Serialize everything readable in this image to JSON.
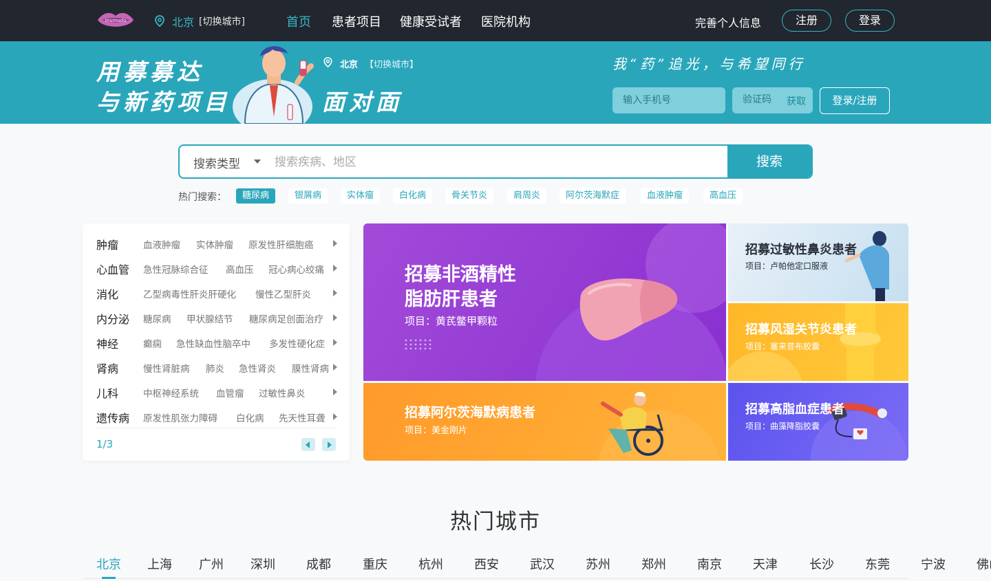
{
  "topnav": {
    "logo_text": "mumuda",
    "city": "北京",
    "switch_city": "[切换城市]",
    "nav": [
      "首页",
      "患者项目",
      "健康受试者",
      "医院机构"
    ],
    "complete_info": "完善个人信息",
    "register": "注册",
    "login": "登录"
  },
  "banner": {
    "slogan_line1": "用募募达",
    "slogan_line2": "与新药项目",
    "slogan_line3": "面对面",
    "city": "北京",
    "switch_city": "【切换城市】",
    "tagline": "我“药”追光，与希望同行",
    "phone_placeholder": "输入手机号",
    "code_placeholder": "验证码",
    "get_code": "获取",
    "login_register": "登录/注册"
  },
  "search": {
    "type_label": "搜索类型",
    "placeholder": "搜索疾病、地区",
    "button": "搜索",
    "hot_label": "热门搜索：",
    "hot_tags": [
      "糖尿病",
      "银屑病",
      "实体瘤",
      "白化病",
      "骨关节炎",
      "肩周炎",
      "阿尔茨海默症",
      "血液肿瘤",
      "高血压"
    ]
  },
  "categories": {
    "rows": [
      {
        "name": "肿瘤",
        "subs": [
          "血液肿瘤",
          "实体肿瘤",
          "原发性肝细胞癌"
        ]
      },
      {
        "name": "心血管",
        "subs": [
          "急性冠脉综合征",
          "高血压",
          "冠心病心绞痛"
        ]
      },
      {
        "name": "消化",
        "subs": [
          "乙型病毒性肝炎肝硬化",
          "慢性乙型肝炎"
        ]
      },
      {
        "name": "内分泌",
        "subs": [
          "糖尿病",
          "甲状腺结节",
          "糖尿病足创面治疗"
        ]
      },
      {
        "name": "神经",
        "subs": [
          "癫痫",
          "急性缺血性脑卒中",
          "多发性硬化症"
        ]
      },
      {
        "name": "肾病",
        "subs": [
          "慢性肾脏病",
          "肺炎",
          "急性肾炎",
          "膜性肾病"
        ]
      },
      {
        "name": "儿科",
        "subs": [
          "中枢神经系统",
          "血管瘤",
          "过敏性鼻炎"
        ]
      },
      {
        "name": "遗传病",
        "subs": [
          "原发性肌张力障碍",
          "白化病",
          "先天性耳聋"
        ]
      }
    ],
    "page": "1/3"
  },
  "cards": [
    {
      "title_line1": "招募非酒精性",
      "title_line2": "脂肪肝患者",
      "project": "项目：黄芪鳖甲颗粒"
    },
    {
      "title": "招募过敏性鼻炎患者",
      "project": "项目：卢帕他定口服液"
    },
    {
      "title": "招募风湿关节炎患者",
      "project": "项目：塞来昔布胶囊"
    },
    {
      "title": "招募阿尔茨海默病患者",
      "project": "项目：美金刚片"
    },
    {
      "title": "招募高脂血症患者",
      "project": "项目：曲藻降脂胶囊"
    }
  ],
  "colors": {
    "primary": "#2aa6bb",
    "nav_bg": "#22262e",
    "card_purple": "#9b3fd6",
    "card_orange": "#ffa92a",
    "card_yellow": "#ffbd2a",
    "card_blue": "#6a5df0",
    "card_lightblue": "#cde4f3"
  },
  "hot_cities": {
    "title": "热门城市",
    "cities": [
      "北京",
      "上海",
      "广州",
      "深圳",
      "成都",
      "重庆",
      "杭州",
      "西安",
      "武汉",
      "苏州",
      "郑州",
      "南京",
      "天津",
      "长沙",
      "东莞",
      "宁波",
      "佛山"
    ]
  }
}
